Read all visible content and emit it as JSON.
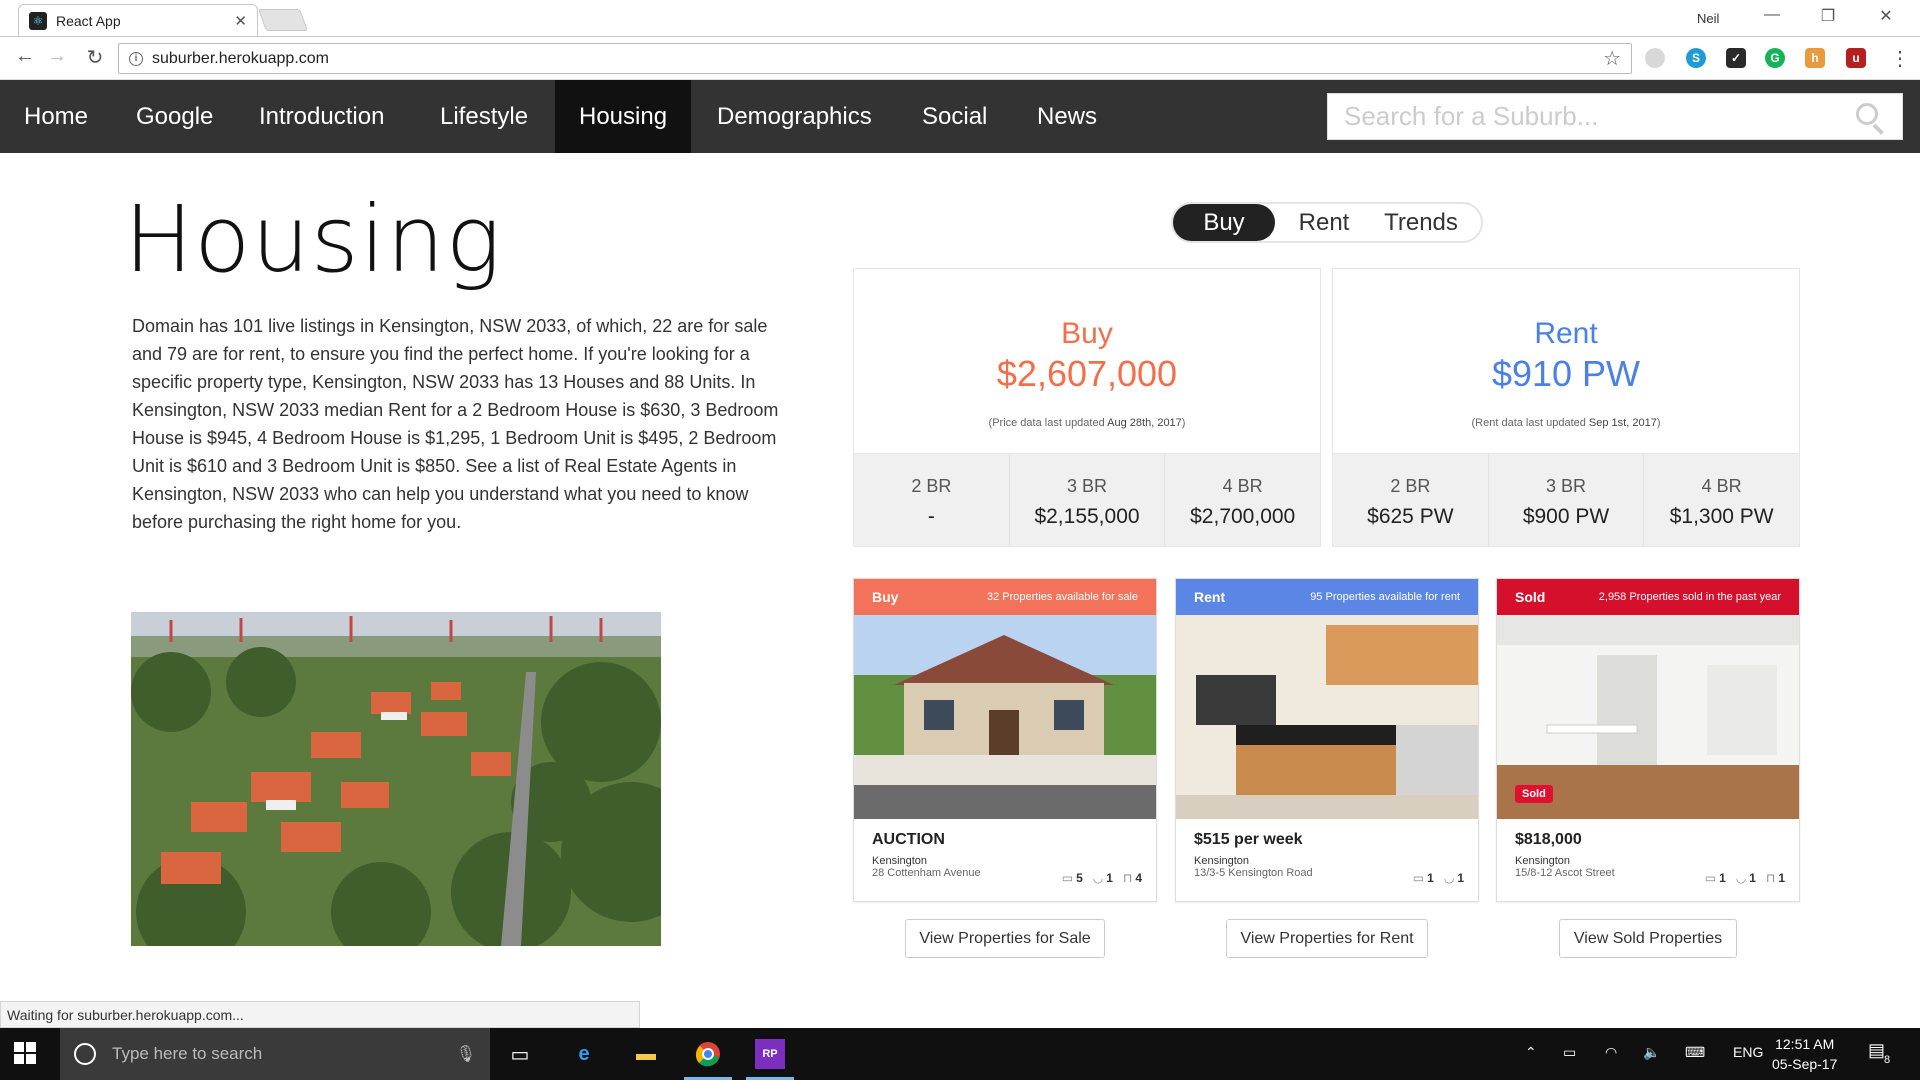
{
  "browser": {
    "tab_title": "React App",
    "tab_close": "✕",
    "profile": "Neil",
    "window_controls": {
      "minimize": "—",
      "restore": "❐",
      "close": "✕"
    },
    "back": "←",
    "forward": "→",
    "reload": "↻",
    "url": "suburber.herokuapp.com",
    "star": "☆",
    "menu": "⋮",
    "status": "Waiting for suburber.herokuapp.com..."
  },
  "nav": {
    "items": [
      "Home",
      "Google",
      "Introduction",
      "Lifestyle",
      "Housing",
      "Demographics",
      "Social",
      "News"
    ],
    "active": "Housing",
    "search_placeholder": "Search for a Suburb..."
  },
  "page": {
    "title": "Housing",
    "intro": "Domain has 101 live listings in Kensington, NSW 2033, of which, 22 are for sale and 79 are for rent, to ensure you find the perfect home. If you're looking for a specific property type, Kensington, NSW 2033 has 13 Houses and 88 Units. In Kensington, NSW 2033 median Rent for a 2 Bedroom House is $630, 3 Bedroom House is $945, 4 Bedroom House is $1,295, 1 Bedroom Unit is $495, 2 Bedroom Unit is $610 and 3 Bedroom Unit is $850. See a list of Real Estate Agents in Kensington, NSW 2033 who can help you understand what you need to know before purchasing the right home for you."
  },
  "toggle": {
    "options": [
      "Buy",
      "Rent",
      "Trends"
    ],
    "active": "Buy"
  },
  "stats": {
    "buy": {
      "label": "Buy",
      "value": "$2,607,000",
      "note_prefix": "(Price data last updated ",
      "note_date": "Aug 28th, 2017",
      "note_suffix": ")",
      "color": "#f26f4b",
      "breakdown": [
        {
          "br": "2 BR",
          "price": "-"
        },
        {
          "br": "3 BR",
          "price": "$2,155,000"
        },
        {
          "br": "4 BR",
          "price": "$2,700,000"
        }
      ]
    },
    "rent": {
      "label": "Rent",
      "value": "$910 PW",
      "note_prefix": "(Rent data last updated ",
      "note_date": "Sep 1st, 2017",
      "note_suffix": ")",
      "color": "#4a80e8",
      "breakdown": [
        {
          "br": "2 BR",
          "price": "$625 PW"
        },
        {
          "br": "3 BR",
          "price": "$900 PW"
        },
        {
          "br": "4 BR",
          "price": "$1,300 PW"
        }
      ]
    }
  },
  "listings": [
    {
      "kind": "Buy",
      "availability": "32 Properties available for sale",
      "color": "#f2735a",
      "price": "AUCTION",
      "suburb": "Kensington",
      "address": "28 Cottenham Avenue",
      "beds": "5",
      "baths": "1",
      "cars": "4",
      "button": "View Properties for Sale"
    },
    {
      "kind": "Rent",
      "availability": "95 Properties available for rent",
      "color": "#5b86e5",
      "price": "$515 per week",
      "suburb": "Kensington",
      "address": "13/3-5 Kensington Road",
      "beds": "1",
      "baths": "1",
      "button": "View Properties for Rent"
    },
    {
      "kind": "Sold",
      "availability": "2,958 Properties sold in the past year",
      "color": "#d5102c",
      "price": "$818,000",
      "suburb": "Kensington",
      "address": "15/8-12 Ascot Street",
      "beds": "1",
      "baths": "1",
      "cars": "1",
      "badge": "Sold",
      "button": "View Sold Properties"
    }
  ],
  "taskbar": {
    "search_placeholder": "Type here to search",
    "language": "ENG",
    "time": "12:51 AM",
    "date": "05-Sep-17",
    "notifications": "8"
  }
}
